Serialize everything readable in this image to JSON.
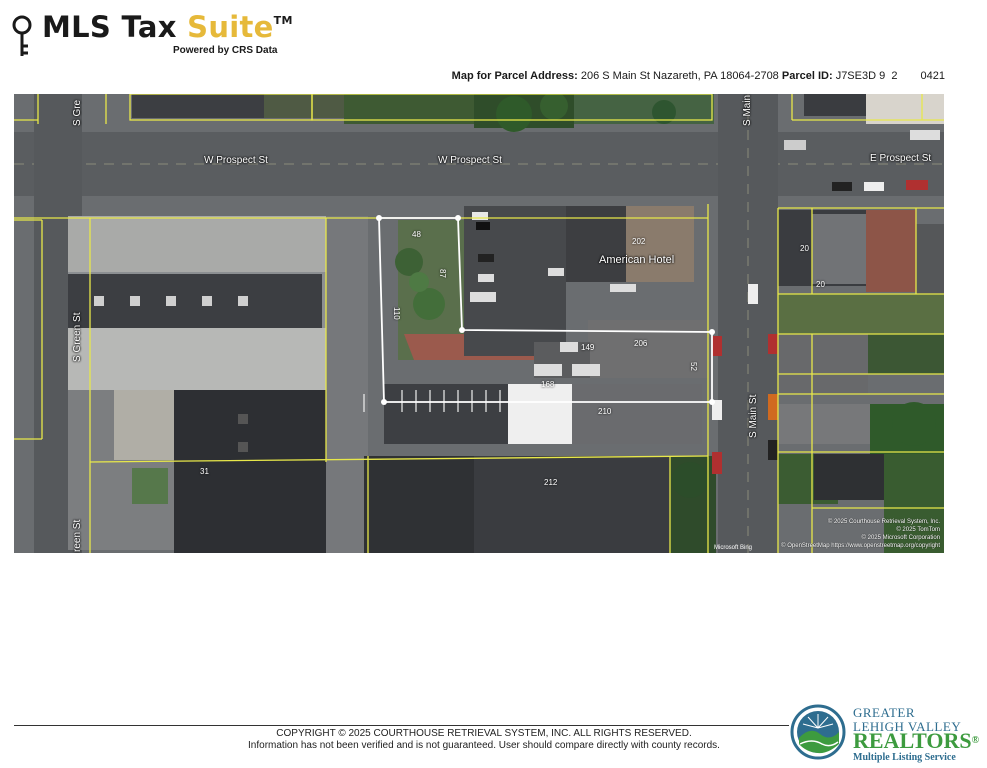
{
  "header": {
    "brand_main": "MLS Tax ",
    "brand_accent": "Suite",
    "brand_tm": "TM",
    "powered_by": "Powered by CRS Data"
  },
  "parcel": {
    "address_label": "Map for Parcel Address:",
    "address": "206 S Main St Nazareth, PA 18064-2708",
    "id_label": "Parcel ID:",
    "id": "J7SE3D 9  2",
    "id_suffix": "0421"
  },
  "map": {
    "streets": {
      "w_prospect_1": "W Prospect St",
      "w_prospect_2": "W Prospect St",
      "e_prospect": "E Prospect St",
      "s_green_top": "S Gre",
      "s_green": "S Green St",
      "green_bottom": "reen St",
      "s_main_top": "S Main",
      "s_main": "S Main St"
    },
    "place": "American Hotel",
    "parcel_numbers": {
      "p48": "48",
      "p87": "87",
      "p110": "110",
      "p202": "202",
      "p206": "206",
      "p149": "149",
      "p168": "168",
      "p210": "210",
      "p52": "52",
      "p31": "31",
      "p212": "212",
      "p20a": "20",
      "p20b": "20"
    },
    "attribution": [
      "© 2025 Courthouse Retrieval System, Inc.",
      "© 2025 TomTom",
      "© 2025 Microsoft Corporation",
      "© OpenStreetMap https://www.openstreetmap.org/copyright"
    ],
    "ms_logo": "Microsoft Bing"
  },
  "footer": {
    "copyright": "COPYRIGHT © 2025 COURTHOUSE RETRIEVAL SYSTEM, INC. ALL RIGHTS RESERVED.",
    "disclaimer": "Information has not been verified and is not guaranteed. User should compare directly with county records.",
    "org_line1": "GREATER",
    "org_line2": "LEHIGH VALLEY",
    "org_line3": "REALTORS",
    "org_reg": "®",
    "org_line4": "Multiple Listing Service"
  },
  "colors": {
    "suite_accent": "#e6b93a",
    "parcel_lines": "#e8e84a",
    "subject_outline": "#ffffff",
    "realtors_green": "#3d9b3f",
    "realtors_blue": "#2e6d8f"
  }
}
